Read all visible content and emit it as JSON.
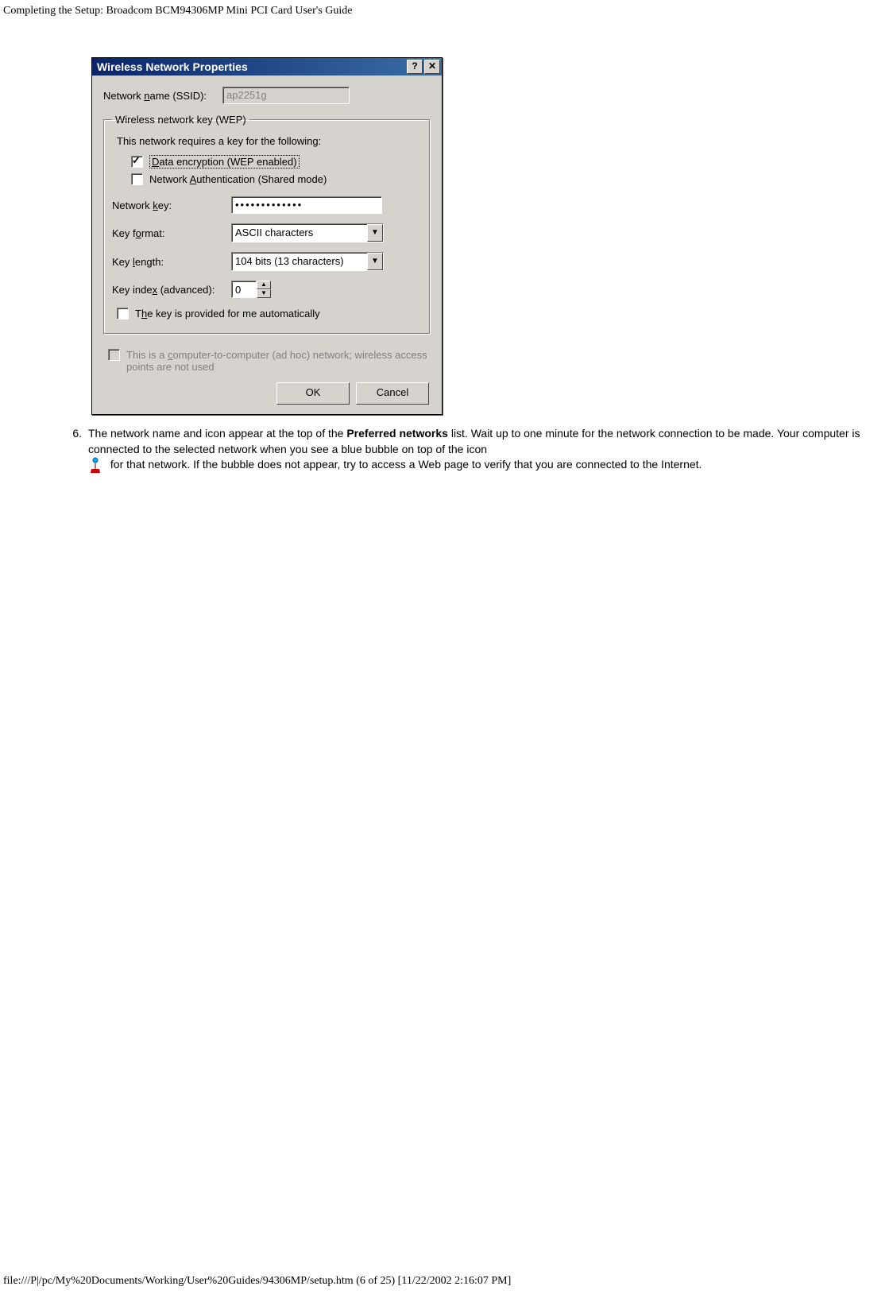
{
  "header": {
    "title": "Completing the Setup: Broadcom BCM94306MP Mini PCI Card User's Guide"
  },
  "dialog": {
    "title": "Wireless Network Properties",
    "help_btn": "?",
    "close_btn": "✕",
    "ssid": {
      "label_pre": "Network ",
      "label_u": "n",
      "label_post": "ame (SSID):",
      "value": "ap2251g"
    },
    "wep_group": {
      "legend": "Wireless network key (WEP)",
      "intro": "This network requires a key for the following:",
      "enc": {
        "u": "D",
        "text": "ata encryption (WEP enabled)",
        "checked": true
      },
      "auth": {
        "pre": "Network ",
        "u": "A",
        "post": "uthentication (Shared mode)",
        "checked": false
      },
      "key": {
        "pre": "Network ",
        "u": "k",
        "post": "ey:",
        "value": "•••••••••••••"
      },
      "format": {
        "pre": "Key f",
        "u": "o",
        "post": "rmat:",
        "value": "ASCII characters"
      },
      "length": {
        "pre": "Key ",
        "u": "l",
        "post": "ength:",
        "value": "104 bits (13 characters)"
      },
      "index": {
        "pre": "Key inde",
        "u": "x",
        "post": " (advanced):",
        "value": "0"
      },
      "auto": {
        "pre": "T",
        "u": "h",
        "post": "e key is provided for me automatically",
        "checked": false
      }
    },
    "adhoc": {
      "pre": "This is a ",
      "u": "c",
      "post": "omputer-to-computer (ad hoc) network; wireless access points are not used"
    },
    "ok": "OK",
    "cancel": "Cancel"
  },
  "instruction": {
    "ordinal": "6.",
    "text_a": "The network name and icon appear at the top of the ",
    "bold": "Preferred networks",
    "text_b": " list. Wait up to one minute for the network connection to be made. Your computer is connected to the selected network when you see a blue bubble on top of the icon ",
    "text_c": " for that network. If the bubble does not appear, try to access a Web page to verify that you are connected to the Internet."
  },
  "footer": {
    "text": "file:///P|/pc/My%20Documents/Working/User%20Guides/94306MP/setup.htm (6 of 25) [11/22/2002 2:16:07 PM]"
  }
}
